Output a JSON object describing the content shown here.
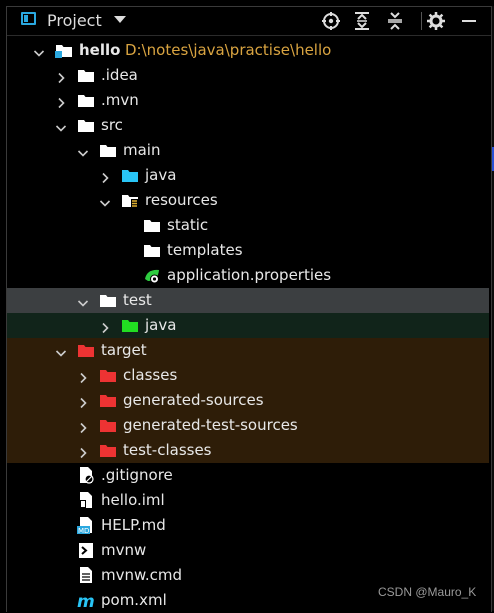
{
  "toolbar": {
    "title": "Project"
  },
  "tree": [
    {
      "label": "hello",
      "path": "D:\\notes\\java\\practise\\hello",
      "expanded": true,
      "icon": "module-folder-icon"
    },
    {
      "label": ".idea",
      "expanded": false,
      "icon": "folder-icon"
    },
    {
      "label": ".mvn",
      "expanded": false,
      "icon": "folder-icon"
    },
    {
      "label": "src",
      "expanded": true,
      "icon": "folder-icon"
    },
    {
      "label": "main",
      "expanded": true,
      "icon": "folder-icon"
    },
    {
      "label": "java",
      "expanded": false,
      "icon": "source-folder-icon"
    },
    {
      "label": "resources",
      "expanded": true,
      "icon": "resources-folder-icon"
    },
    {
      "label": "static",
      "icon": "folder-icon"
    },
    {
      "label": "templates",
      "icon": "folder-icon"
    },
    {
      "label": "application.properties",
      "icon": "spring-properties-icon"
    },
    {
      "label": "test",
      "expanded": true,
      "icon": "folder-icon"
    },
    {
      "label": "java",
      "expanded": false,
      "icon": "test-source-folder-icon"
    },
    {
      "label": "target",
      "expanded": true,
      "icon": "excluded-folder-icon"
    },
    {
      "label": "classes",
      "expanded": false,
      "icon": "excluded-folder-icon"
    },
    {
      "label": "generated-sources",
      "expanded": false,
      "icon": "excluded-folder-icon"
    },
    {
      "label": "generated-test-sources",
      "expanded": false,
      "icon": "excluded-folder-icon"
    },
    {
      "label": "test-classes",
      "expanded": false,
      "icon": "excluded-folder-icon"
    },
    {
      "label": ".gitignore",
      "icon": "gitignore-file-icon"
    },
    {
      "label": "hello.iml",
      "icon": "iml-file-icon"
    },
    {
      "label": "HELP.md",
      "icon": "markdown-file-icon"
    },
    {
      "label": "mvnw",
      "icon": "shell-script-icon"
    },
    {
      "label": "mvnw.cmd",
      "icon": "text-file-icon"
    },
    {
      "label": "pom.xml",
      "icon": "maven-icon"
    }
  ],
  "colors": {
    "folder": "#ffffff",
    "source_folder": "#29c5f6",
    "test_folder": "#22dd22",
    "excluded_folder": "#ee3333",
    "path_text": "#d9a441",
    "spring_green": "#2ecc40"
  },
  "watermark": "CSDN @Mauro_K"
}
